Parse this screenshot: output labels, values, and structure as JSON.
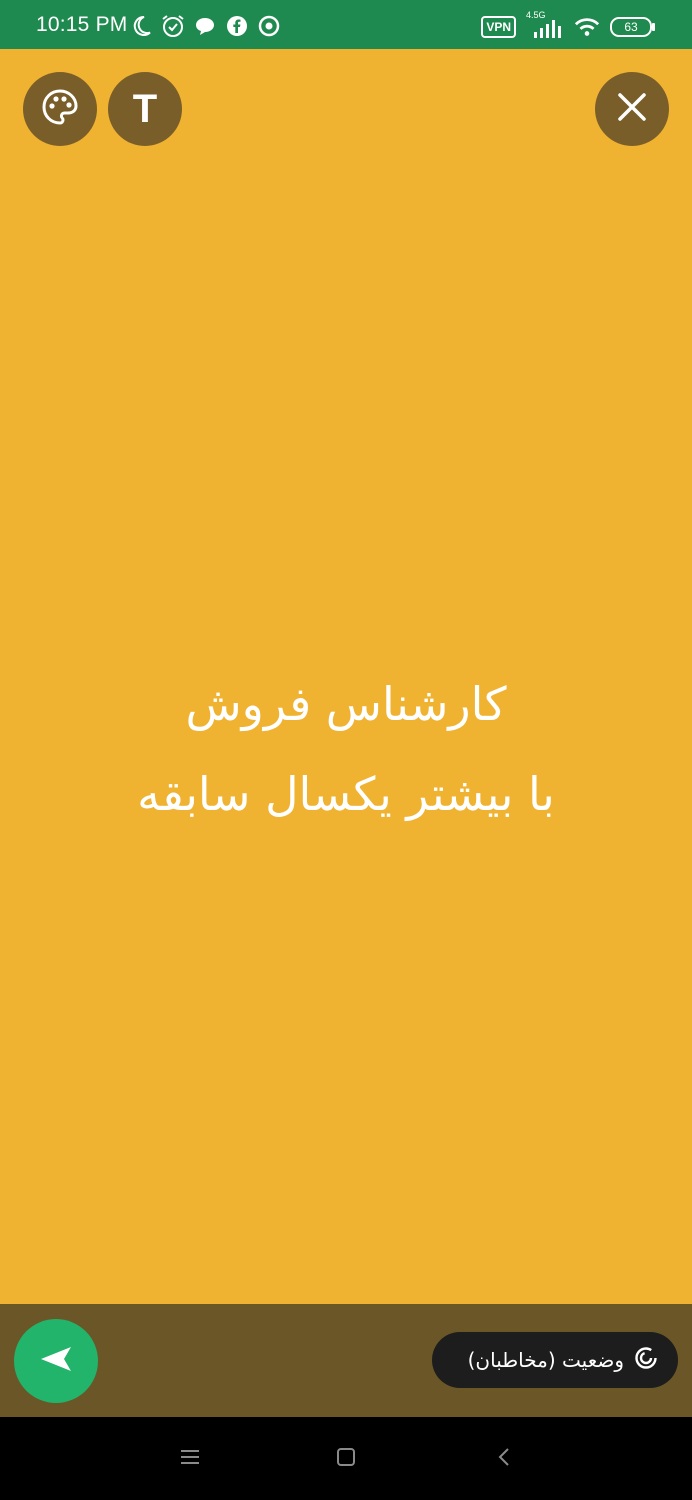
{
  "status_bar": {
    "time": "10:15 PM",
    "left_icons": [
      "moon-icon",
      "alarm-icon",
      "message-icon",
      "facebook-icon",
      "chrome-icon"
    ],
    "vpn_label": "VPN",
    "network_label": "4.5G",
    "battery_level": "63"
  },
  "editor": {
    "background_color": "#EFB331",
    "status_text_lines": [
      "کارشناس فروش",
      "با بیشتر یکسال سابقه"
    ],
    "text_color": "#FFFFFF",
    "text_button_label": "T"
  },
  "bottom_bar": {
    "audience_label": "وضعیت (مخاطبان)"
  },
  "colors": {
    "status_bar": "#1E8A4F",
    "accent_green": "#21B46A",
    "button_overlay": "#7A5E2A",
    "bottom_bar": "#6B5628"
  }
}
